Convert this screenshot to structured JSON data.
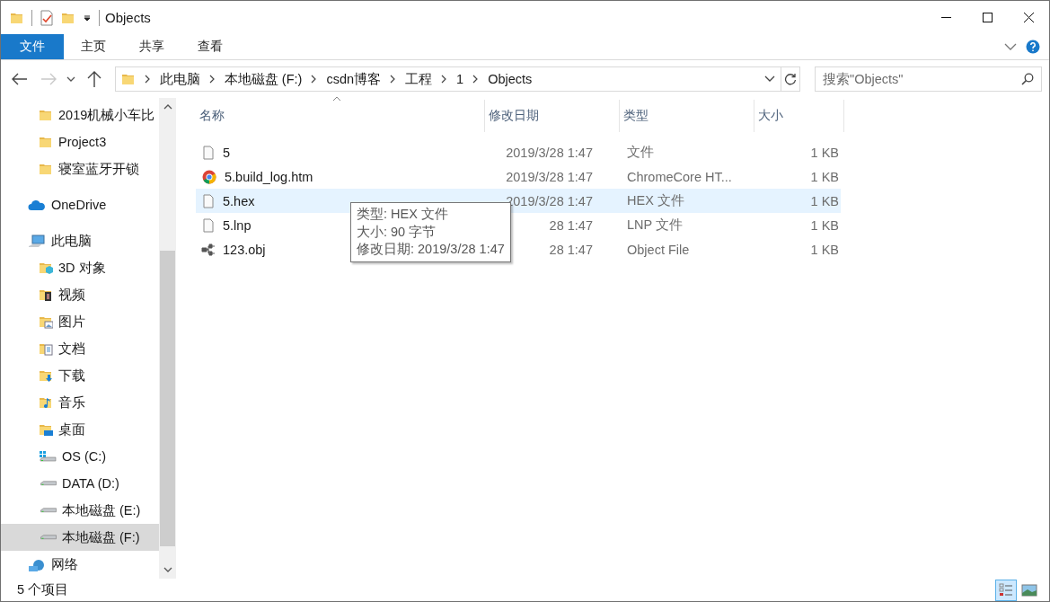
{
  "window": {
    "title": "Objects"
  },
  "ribbon_tabs": [
    {
      "label": "文件",
      "selected": true
    },
    {
      "label": "主页",
      "selected": false
    },
    {
      "label": "共享",
      "selected": false
    },
    {
      "label": "查看",
      "selected": false
    }
  ],
  "address_bar": {
    "crumbs": [
      "此电脑",
      "本地磁盘 (F:)",
      "csdn博客",
      "工程",
      "1",
      "Objects"
    ]
  },
  "search": {
    "placeholder": "搜索\"Objects\""
  },
  "sidebar": {
    "pinned": [
      {
        "label": "2019机械小车比",
        "kind": "folder",
        "selected": false
      },
      {
        "label": "Project3",
        "kind": "folder",
        "selected": false
      },
      {
        "label": "寝室蓝牙开锁",
        "kind": "folder",
        "selected": false
      }
    ],
    "items": [
      {
        "label": "OneDrive",
        "kind": "cloud",
        "selected": false
      },
      {
        "label": "此电脑",
        "kind": "pc",
        "selected": false,
        "children": [
          {
            "label": "3D 对象",
            "kind": "cube",
            "selected": false
          },
          {
            "label": "视频",
            "kind": "video",
            "selected": false
          },
          {
            "label": "图片",
            "kind": "pictures",
            "selected": false
          },
          {
            "label": "文档",
            "kind": "documents",
            "selected": false
          },
          {
            "label": "下载",
            "kind": "downloads",
            "selected": false
          },
          {
            "label": "音乐",
            "kind": "music",
            "selected": false
          },
          {
            "label": "桌面",
            "kind": "desktop",
            "selected": false
          },
          {
            "label": "OS (C:)",
            "kind": "system-drive",
            "selected": false
          },
          {
            "label": "DATA (D:)",
            "kind": "drive",
            "selected": false
          },
          {
            "label": "本地磁盘 (E:)",
            "kind": "drive",
            "selected": false
          },
          {
            "label": "本地磁盘 (F:)",
            "kind": "drive",
            "selected": true
          }
        ]
      },
      {
        "label": "网络",
        "kind": "network",
        "selected": false
      }
    ]
  },
  "table": {
    "columns": [
      "名称",
      "修改日期",
      "类型",
      "大小"
    ],
    "rows": [
      {
        "name": "5",
        "kind": "file",
        "modified": "2019/3/28 1:47",
        "type": "文件",
        "size": "1 KB",
        "selected": false
      },
      {
        "name": "5.build_log.htm",
        "kind": "browser",
        "modified": "2019/3/28 1:47",
        "type": "ChromeCore HT...",
        "size": "1 KB",
        "selected": false
      },
      {
        "name": "5.hex",
        "kind": "file",
        "modified": "2019/3/28 1:47",
        "type": "HEX 文件",
        "size": "1 KB",
        "selected": true
      },
      {
        "name": "5.lnp",
        "kind": "file",
        "modified": "28 1:47",
        "type": "LNP 文件",
        "size": "1 KB",
        "selected": false
      },
      {
        "name": "123.obj",
        "kind": "object",
        "modified": "28 1:47",
        "type": "Object File",
        "size": "1 KB",
        "selected": false
      }
    ]
  },
  "tooltip": [
    "类型: HEX 文件",
    "大小: 90 字节",
    "修改日期: 2019/3/28 1:47"
  ],
  "status_bar": {
    "item_count": "5 个项目",
    "views": [
      {
        "kind": "details",
        "selected": true
      },
      {
        "kind": "large-icons",
        "selected": false
      }
    ]
  }
}
